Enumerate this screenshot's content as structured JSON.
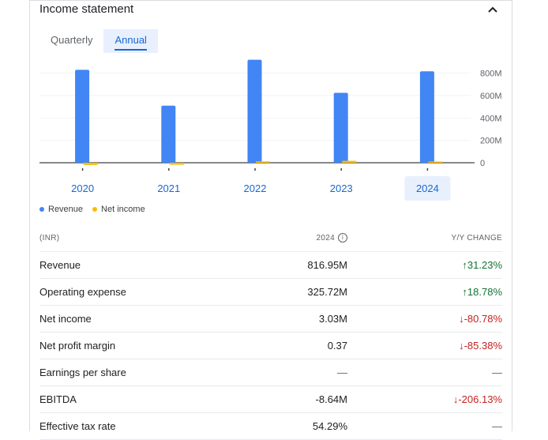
{
  "header": {
    "title": "Income statement"
  },
  "tabs": [
    {
      "label": "Quarterly"
    },
    {
      "label": "Annual"
    }
  ],
  "active_tab": "Annual",
  "colors": {
    "revenue": "#4285f4",
    "net_income": "#fbbc04",
    "up": "#137333",
    "down": "#c5221f",
    "accent": "#1967d2"
  },
  "chart_data": {
    "type": "bar",
    "categories": [
      "2020",
      "2021",
      "2022",
      "2023",
      "2024"
    ],
    "selected_category": "2024",
    "series": [
      {
        "name": "Revenue",
        "values": [
          830,
          510,
          920,
          625,
          817
        ]
      },
      {
        "name": "Net income",
        "values": [
          -20,
          -18,
          12,
          17,
          3
        ]
      }
    ],
    "y_ticks": [
      "800M",
      "600M",
      "400M",
      "200M",
      "0"
    ],
    "y_tick_values": [
      800,
      600,
      400,
      200,
      0
    ],
    "ylim": [
      -50,
      1000
    ],
    "grid": true,
    "legend": "bottom-left"
  },
  "legend": {
    "revenue": "Revenue",
    "net_income": "Net income"
  },
  "table": {
    "header": {
      "col1": "(INR)",
      "col2": "2024",
      "col3": "Y/Y CHANGE"
    },
    "rows": [
      {
        "label": "Revenue",
        "value": "816.95M",
        "change": "31.23%",
        "dir": "up"
      },
      {
        "label": "Operating expense",
        "value": "325.72M",
        "change": "18.78%",
        "dir": "up"
      },
      {
        "label": "Net income",
        "value": "3.03M",
        "change": "-80.78%",
        "dir": "down"
      },
      {
        "label": "Net profit margin",
        "value": "0.37",
        "change": "-85.38%",
        "dir": "down"
      },
      {
        "label": "Earnings per share",
        "value": "—",
        "change": "—",
        "dir": "none"
      },
      {
        "label": "EBITDA",
        "value": "-8.64M",
        "change": "-206.13%",
        "dir": "down"
      },
      {
        "label": "Effective tax rate",
        "value": "54.29%",
        "change": "—",
        "dir": "none"
      }
    ]
  }
}
